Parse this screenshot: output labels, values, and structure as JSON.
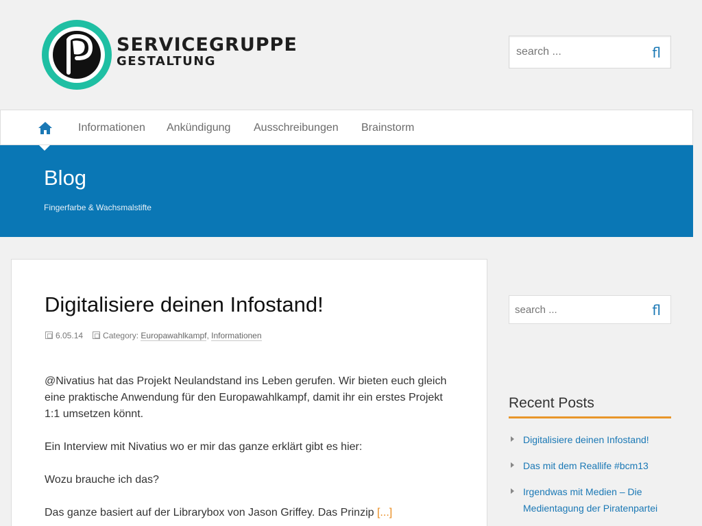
{
  "header": {
    "logo_line1": "SERVICEGRUPPE",
    "logo_line2": "GESTALTUNG",
    "search": {
      "placeholder": "search ...",
      "button_glyph": "fl"
    }
  },
  "nav": {
    "home_icon": "home-icon",
    "items": [
      {
        "label": "Informationen"
      },
      {
        "label": "Ankündigung"
      },
      {
        "label": "Ausschreibungen"
      },
      {
        "label": "Brainstorm"
      }
    ]
  },
  "banner": {
    "title": "Blog",
    "subtitle": "Fingerfarbe & Wachsmalstifte"
  },
  "article": {
    "title": "Digitalisiere deinen Infostand!",
    "date": "6.05.14",
    "category_label": "Category:",
    "categories": [
      "Europawahlkampf",
      "Informationen"
    ],
    "paragraphs": [
      "@Nivatius hat das Projekt Neulandstand ins Leben gerufen. Wir bieten euch gleich eine praktische Anwendung für den Europawahlkampf, damit ihr ein erstes Projekt 1:1 umsetzen könnt.",
      "Ein Interview mit Nivatius wo er mir das ganze erklärt gibt es hier:",
      "Wozu brauche ich das?",
      "Das ganze basiert auf der Librarybox von Jason Griffey. Das Prinzip"
    ],
    "more_link": "[...]"
  },
  "sidebar": {
    "search": {
      "placeholder": "search ...",
      "button_glyph": "fl"
    },
    "recent_title": "Recent Posts",
    "recent_posts": [
      {
        "label": "Digitalisiere deinen Infostand!"
      },
      {
        "label": "Das mit dem Reallife #bcm13"
      },
      {
        "label": "Irgendwas mit Medien – Die Medientagung der Piratenpartei"
      }
    ]
  },
  "colors": {
    "brand_blue": "#0a77b5",
    "logo_teal": "#1fbfa3",
    "accent_orange": "#e8962a",
    "link_blue": "#1a78b5"
  }
}
